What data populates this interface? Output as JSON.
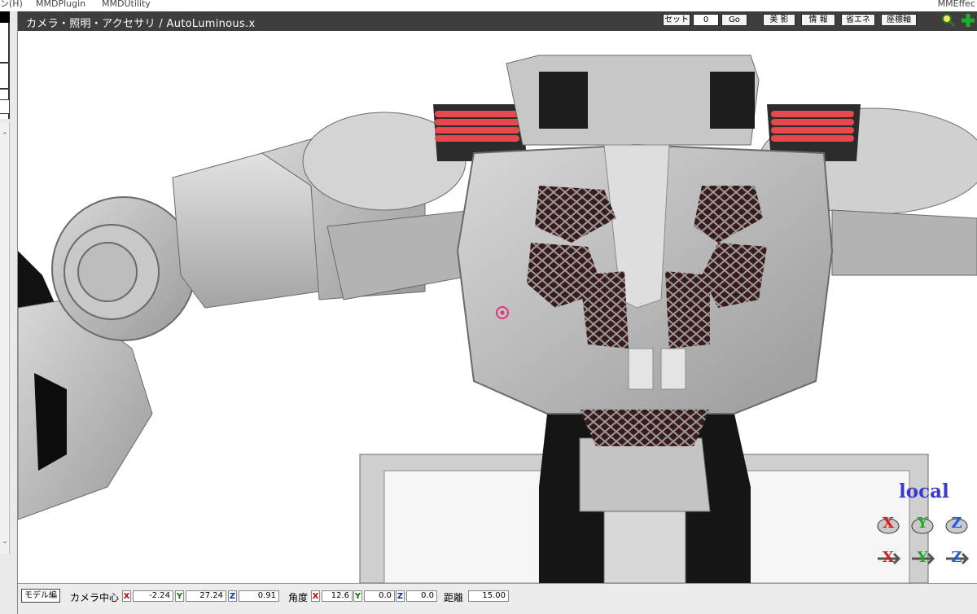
{
  "menu": {
    "items": [
      "ン(H)",
      "MMDPlugin",
      "MMDUtility"
    ],
    "right_label": "MMEffec"
  },
  "viewer": {
    "title": "カメラ・照明・アクセサリ / AutoLuminous.x",
    "set_label": "セット",
    "frame_value": "0",
    "go_label": "Go",
    "toggles": [
      "美 影",
      "情 報",
      "省エネ",
      "座標軸"
    ]
  },
  "overlay": {
    "local_label": "local",
    "gizmo_axes": [
      "X",
      "Y",
      "Z"
    ]
  },
  "status": {
    "model_edit_label": "モデル編",
    "camera_center_label": "カメラ中心",
    "center": {
      "x": "-2.24",
      "y": "27.24",
      "z": "0.91"
    },
    "angle_label": "角度",
    "angle": {
      "x": "12.6",
      "y": "0.0",
      "z": "0.0"
    },
    "distance_label": "距離",
    "distance": "15.00"
  },
  "colors": {
    "titlebar": "#3e3e3e",
    "vent_red": "#e5484d",
    "axis_x": "#d42020",
    "axis_y": "#1faa2a",
    "axis_z": "#2a5ae0"
  }
}
